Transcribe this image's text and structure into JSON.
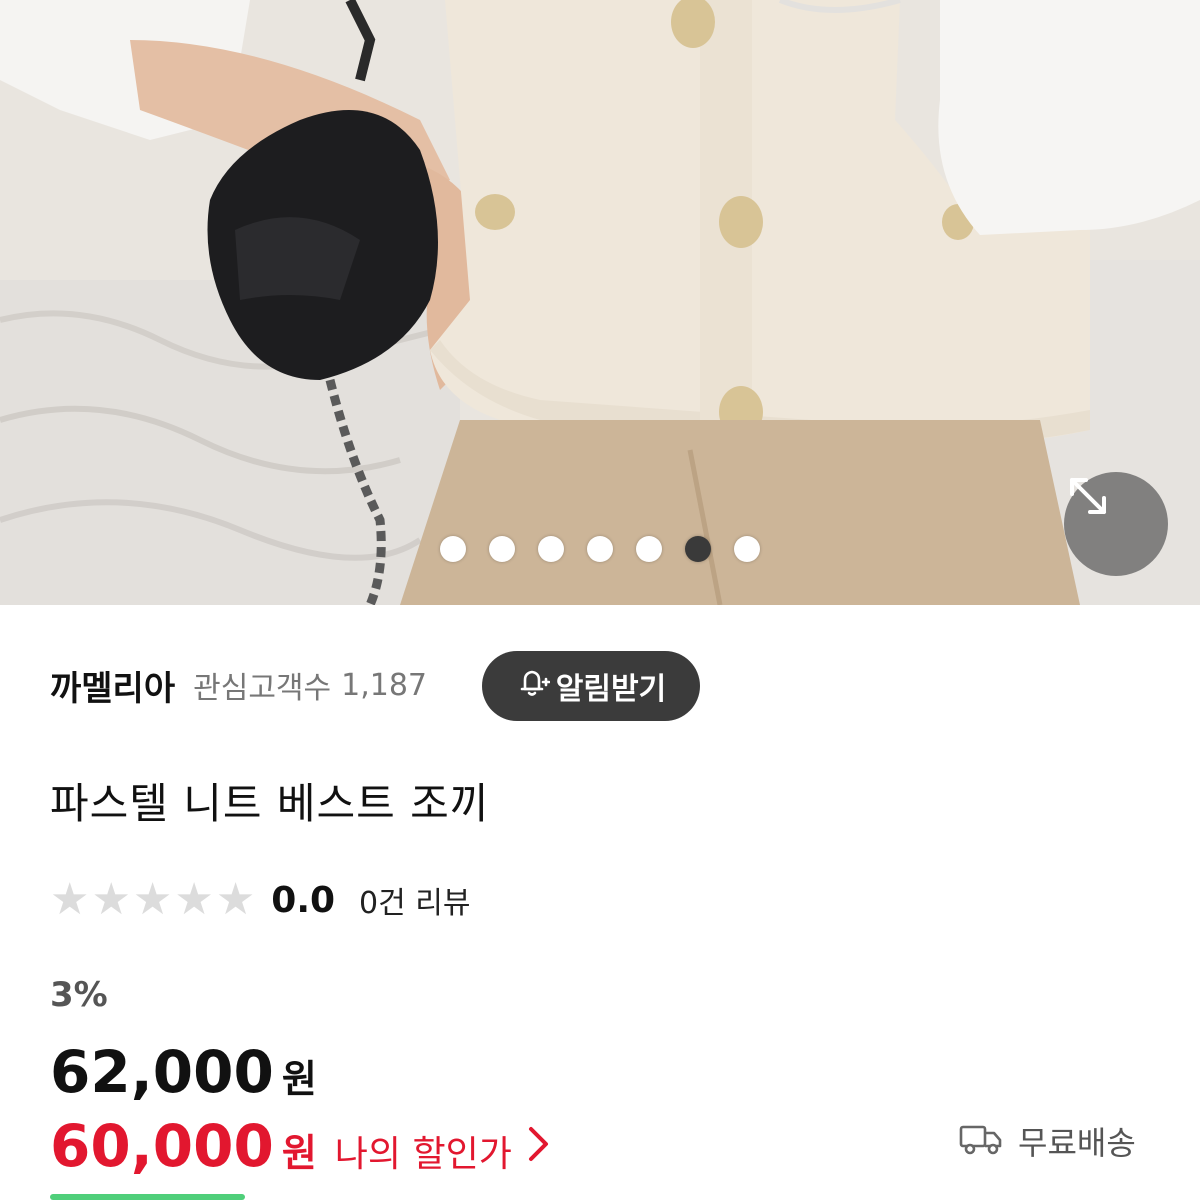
{
  "gallery": {
    "image_alt": "product-photo",
    "dot_count": 7,
    "active_index": 5
  },
  "store": {
    "name": "까멜리아",
    "followers_label": "관심고객수",
    "followers_count": "1,187",
    "alert_button_label": "알림받기"
  },
  "product": {
    "title": "파스텔 니트 베스트 조끼",
    "rating_value": "0.0",
    "rating_stars": 0,
    "review_count": "0건 리뷰",
    "discount_percent": "3%",
    "price": "62,000",
    "price_unit": "원",
    "my_price": "60,000",
    "my_price_unit": "원",
    "my_price_label": "나의 할인가"
  },
  "shipping": {
    "label": "무료배송",
    "icon": "truck-icon"
  },
  "colors": {
    "accent_red": "#e2172f",
    "dark_button": "#3b3b3b",
    "muted_text": "#777777"
  }
}
